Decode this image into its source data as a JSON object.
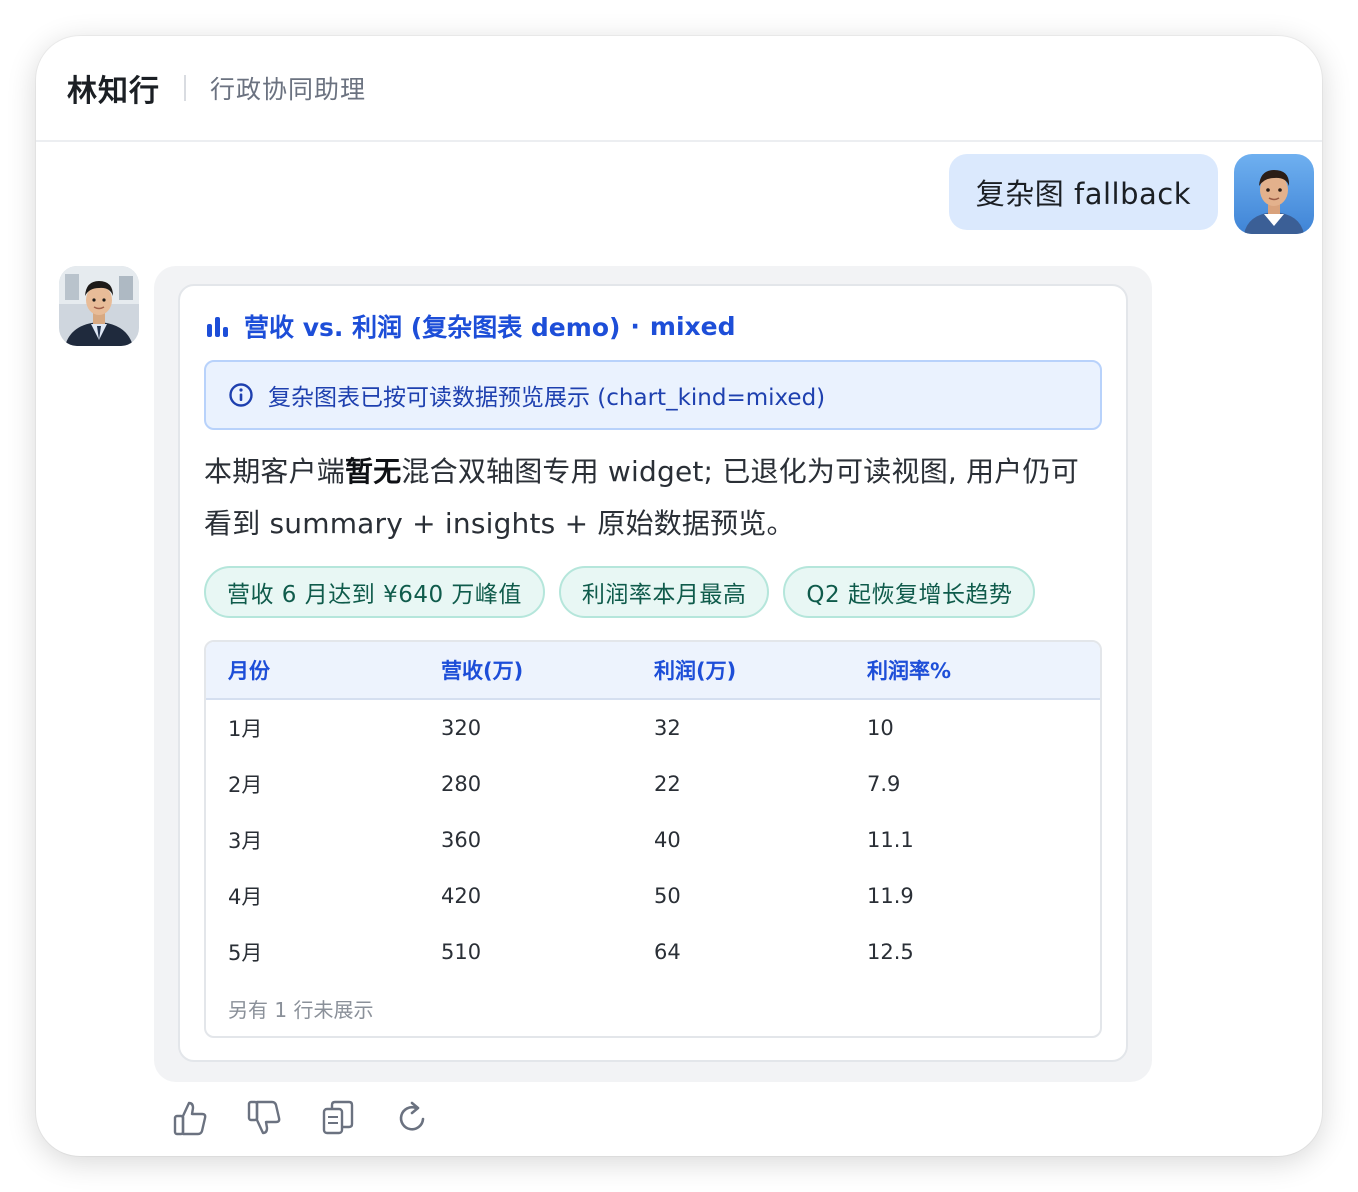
{
  "header": {
    "agent_name": "林知行",
    "agent_role": "行政协同助理"
  },
  "user_message": {
    "text": "复杂图 fallback"
  },
  "card": {
    "title": "营收 vs. 利润 (复杂图表 demo)",
    "title_separator": "·",
    "title_kind": "mixed",
    "title_icon": "bar-chart-icon",
    "notice": {
      "icon": "info-icon",
      "text": "复杂图表已按可读数据预览展示 (chart_kind=mixed)"
    },
    "summary": {
      "before": "本期客户端",
      "bold": "暂无",
      "after": "混合双轴图专用 widget; 已退化为可读视图, 用户仍可看到 summary + insights + 原始数据预览。"
    },
    "insights": [
      "营收 6 月达到 ¥640 万峰值",
      "利润率本月最高",
      "Q2 起恢复增长趋势"
    ],
    "table": {
      "headers": [
        "月份",
        "营收(万)",
        "利润(万)",
        "利润率%"
      ],
      "rows": [
        [
          "1月",
          "320",
          "32",
          "10"
        ],
        [
          "2月",
          "280",
          "22",
          "7.9"
        ],
        [
          "3月",
          "360",
          "40",
          "11.1"
        ],
        [
          "4月",
          "420",
          "50",
          "11.9"
        ],
        [
          "5月",
          "510",
          "64",
          "12.5"
        ]
      ],
      "more_text": "另有 1 行未展示"
    }
  },
  "actions": {
    "icons": [
      "thumbs-up-icon",
      "thumbs-down-icon",
      "copy-icon",
      "refresh-icon"
    ]
  },
  "colors": {
    "accent_blue": "#1d4ed8",
    "user_bubble": "#dbe9fd",
    "notice_bg": "#eaf2fe",
    "chip_bg": "#e8f7f4",
    "chip_text": "#0f5b4b"
  }
}
